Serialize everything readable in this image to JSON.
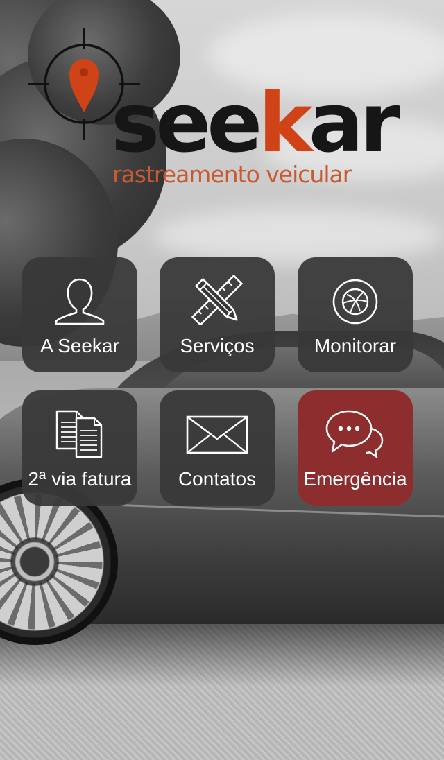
{
  "app": {
    "brand_prefix": "see",
    "brand_accent": "k",
    "brand_suffix": "ar",
    "tagline": "rastreamento veicular"
  },
  "colors": {
    "brand_orange": "#d04316",
    "tile_bg": "#383838",
    "emergency_bg": "#8e2d2d",
    "tile_text": "#ffffff"
  },
  "menu": {
    "items": [
      {
        "label": "A Seekar",
        "icon": "user-icon"
      },
      {
        "label": "Serviços",
        "icon": "ruler-pencil-icon"
      },
      {
        "label": "Monitorar",
        "icon": "dribbble-icon"
      },
      {
        "label": "2ª via fatura",
        "icon": "documents-icon"
      },
      {
        "label": "Contatos",
        "icon": "envelope-icon"
      },
      {
        "label": "Emergência",
        "icon": "chat-bubbles-icon"
      }
    ]
  }
}
